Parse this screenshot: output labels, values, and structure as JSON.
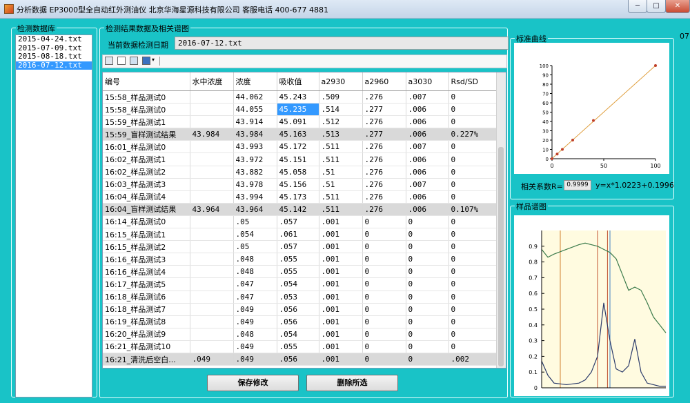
{
  "window": {
    "title": "分析数据  EP3000型全自动红外测油仪 北京华海星源科技有限公司  客服电话 400-677 4881",
    "minimize_icon": "minimize-icon",
    "maximize_icon": "maximize-icon",
    "close_icon": "close-icon"
  },
  "database": {
    "title": "检测数据库",
    "files": [
      "2015-04-24.txt",
      "2015-07-09.txt",
      "2015-08-18.txt",
      "2016-07-12.txt"
    ],
    "selected_index": 3
  },
  "results": {
    "title": "检测结果数据及相关谱图",
    "date_label": "当前数据检测日期",
    "date_value": "2016-07-12.txt",
    "toolbar": [
      "print-icon",
      "preview-icon",
      "book-icon",
      "export-icon"
    ],
    "columns": [
      "编号",
      "水中浓度",
      "浓度",
      "吸收值",
      "a2930",
      "a2960",
      "a3030",
      "Rsd/SD"
    ],
    "rows": [
      {
        "id": "15:58_样品测试0",
        "water": "",
        "conc": "44.062",
        "abs": "45.243",
        "a2930": ".509",
        "a2960": ".276",
        "a3030": ".007",
        "rsd": "0"
      },
      {
        "id": "15:58_样品测试0",
        "water": "",
        "conc": "44.055",
        "abs": "45.235",
        "a2930": ".514",
        "a2960": ".277",
        "a3030": ".006",
        "rsd": "0"
      },
      {
        "id": "15:59_样品测试1",
        "water": "",
        "conc": "43.914",
        "abs": "45.091",
        "a2930": ".512",
        "a2960": ".276",
        "a3030": ".006",
        "rsd": "0"
      },
      {
        "id": "15:59_盲样测试结果",
        "water": "43.984",
        "conc": "43.984",
        "abs": "45.163",
        "a2930": ".513",
        "a2960": ".277",
        "a3030": ".006",
        "rsd": "0.227%",
        "blank": true
      },
      {
        "id": "16:01_样品测试0",
        "water": "",
        "conc": "43.993",
        "abs": "45.172",
        "a2930": ".511",
        "a2960": ".276",
        "a3030": ".007",
        "rsd": "0"
      },
      {
        "id": "16:02_样品测试1",
        "water": "",
        "conc": "43.972",
        "abs": "45.151",
        "a2930": ".511",
        "a2960": ".276",
        "a3030": ".006",
        "rsd": "0"
      },
      {
        "id": "16:02_样品测试2",
        "water": "",
        "conc": "43.882",
        "abs": "45.058",
        "a2930": ".51",
        "a2960": ".276",
        "a3030": ".006",
        "rsd": "0"
      },
      {
        "id": "16:03_样品测试3",
        "water": "",
        "conc": "43.978",
        "abs": "45.156",
        "a2930": ".51",
        "a2960": ".276",
        "a3030": ".007",
        "rsd": "0"
      },
      {
        "id": "16:04_样品测试4",
        "water": "",
        "conc": "43.994",
        "abs": "45.173",
        "a2930": ".511",
        "a2960": ".276",
        "a3030": ".006",
        "rsd": "0"
      },
      {
        "id": "16:04_盲样测试结果",
        "water": "43.964",
        "conc": "43.964",
        "abs": "45.142",
        "a2930": ".511",
        "a2960": ".276",
        "a3030": ".006",
        "rsd": "0.107%",
        "blank": true
      },
      {
        "id": "16:14_样品测试0",
        "water": "",
        "conc": ".05",
        "abs": ".057",
        "a2930": ".001",
        "a2960": "0",
        "a3030": "0",
        "rsd": "0"
      },
      {
        "id": "16:15_样品测试1",
        "water": "",
        "conc": ".054",
        "abs": ".061",
        "a2930": ".001",
        "a2960": "0",
        "a3030": "0",
        "rsd": "0"
      },
      {
        "id": "16:15_样品测试2",
        "water": "",
        "conc": ".05",
        "abs": ".057",
        "a2930": ".001",
        "a2960": "0",
        "a3030": "0",
        "rsd": "0"
      },
      {
        "id": "16:16_样品测试3",
        "water": "",
        "conc": ".048",
        "abs": ".055",
        "a2930": ".001",
        "a2960": "0",
        "a3030": "0",
        "rsd": "0"
      },
      {
        "id": "16:16_样品测试4",
        "water": "",
        "conc": ".048",
        "abs": ".055",
        "a2930": ".001",
        "a2960": "0",
        "a3030": "0",
        "rsd": "0"
      },
      {
        "id": "16:17_样品测试5",
        "water": "",
        "conc": ".047",
        "abs": ".054",
        "a2930": ".001",
        "a2960": "0",
        "a3030": "0",
        "rsd": "0"
      },
      {
        "id": "16:18_样品测试6",
        "water": "",
        "conc": ".047",
        "abs": ".053",
        "a2930": ".001",
        "a2960": "0",
        "a3030": "0",
        "rsd": "0"
      },
      {
        "id": "16:18_样品测试7",
        "water": "",
        "conc": ".049",
        "abs": ".056",
        "a2930": ".001",
        "a2960": "0",
        "a3030": "0",
        "rsd": "0"
      },
      {
        "id": "16:19_样品测试8",
        "water": "",
        "conc": ".049",
        "abs": ".056",
        "a2930": ".001",
        "a2960": "0",
        "a3030": "0",
        "rsd": "0"
      },
      {
        "id": "16:20_样品测试9",
        "water": "",
        "conc": ".048",
        "abs": ".054",
        "a2930": ".001",
        "a2960": "0",
        "a3030": "0",
        "rsd": "0"
      },
      {
        "id": "16:21_样品测试10",
        "water": "",
        "conc": ".049",
        "abs": ".055",
        "a2930": ".001",
        "a2960": "0",
        "a3030": "0",
        "rsd": "0"
      },
      {
        "id": "16:21_清洗后空白...",
        "water": ".049",
        "conc": ".049",
        "abs": ".056",
        "a2930": ".001",
        "a2960": "0",
        "a3030": "0",
        "rsd": ".002",
        "blank": true
      }
    ],
    "highlighted_cell": {
      "row": 1,
      "column": "abs"
    },
    "save_button": "保存修改",
    "delete_button": "删除所选"
  },
  "calibration": {
    "title": "标准曲线",
    "r_label": "相关系数R=",
    "r_value": "0.9999",
    "equation": "y=x*1.0223+0.1996",
    "clock_fragment": "07:"
  },
  "spectrum": {
    "title": "样品谱图"
  },
  "colors": {
    "background": "#19c3c7",
    "selection": "#3399ff",
    "blank_row": "#d9d9d9",
    "cal_line": "#e0a040",
    "cal_points": "#c0402a",
    "spec_green": "#3a7a4a",
    "spec_blue": "#2a3a6a"
  },
  "chart_data": [
    {
      "type": "scatter",
      "title": "标准曲线",
      "x": [
        0,
        5,
        10,
        20,
        40,
        100
      ],
      "y": [
        0,
        5,
        10,
        20,
        41,
        102
      ],
      "fit": {
        "slope": 1.0223,
        "intercept": 0.1996
      },
      "xticks": [
        0,
        50,
        100
      ],
      "yticks": [
        0,
        10,
        20,
        30,
        40,
        50,
        60,
        70,
        80,
        90,
        100
      ],
      "xlim": [
        0,
        100
      ],
      "ylim": [
        0,
        100
      ],
      "grid": false
    },
    {
      "type": "line",
      "title": "样品谱图",
      "ylim": [
        0,
        1.0
      ],
      "yticks": [
        0,
        0.1,
        0.2,
        0.3,
        0.4,
        0.5,
        0.6,
        0.7,
        0.8,
        0.9
      ],
      "x": [
        0,
        0.05,
        0.1,
        0.2,
        0.3,
        0.35,
        0.4,
        0.45,
        0.5,
        0.55,
        0.6,
        0.65,
        0.7,
        0.75,
        0.8,
        0.85,
        0.9,
        0.95,
        1.0
      ],
      "series": [
        {
          "values": [
            0.88,
            0.83,
            0.85,
            0.88,
            0.91,
            0.92,
            0.91,
            0.9,
            0.88,
            0.86,
            0.82,
            0.72,
            0.62,
            0.64,
            0.62,
            0.54,
            0.45,
            0.4,
            0.35
          ]
        },
        {
          "values": [
            0.17,
            0.08,
            0.03,
            0.02,
            0.03,
            0.05,
            0.1,
            0.2,
            0.54,
            0.3,
            0.12,
            0.1,
            0.14,
            0.31,
            0.1,
            0.03,
            0.02,
            0.01,
            0.01
          ]
        }
      ],
      "vlines": [
        0.15,
        0.45,
        0.53,
        0.55
      ]
    }
  ]
}
